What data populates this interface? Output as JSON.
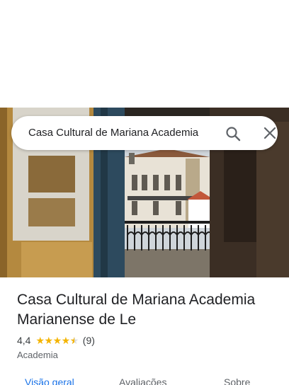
{
  "search": {
    "query": "Casa Cultural de Mariana Academia",
    "search_icon": "search-icon",
    "close_icon": "close-icon"
  },
  "place": {
    "name": "Casa Cultural de Mariana Academia Marianense de Le",
    "rating": "4,4",
    "rating_fraction": 0.88,
    "review_count": "(9)",
    "category": "Academia"
  },
  "tabs": [
    {
      "label": "Visão geral",
      "active": true
    },
    {
      "label": "Avaliações",
      "active": false
    },
    {
      "label": "Sobre",
      "active": false
    }
  ],
  "colors": {
    "accent": "#1a73e8",
    "star": "#f4b400"
  }
}
